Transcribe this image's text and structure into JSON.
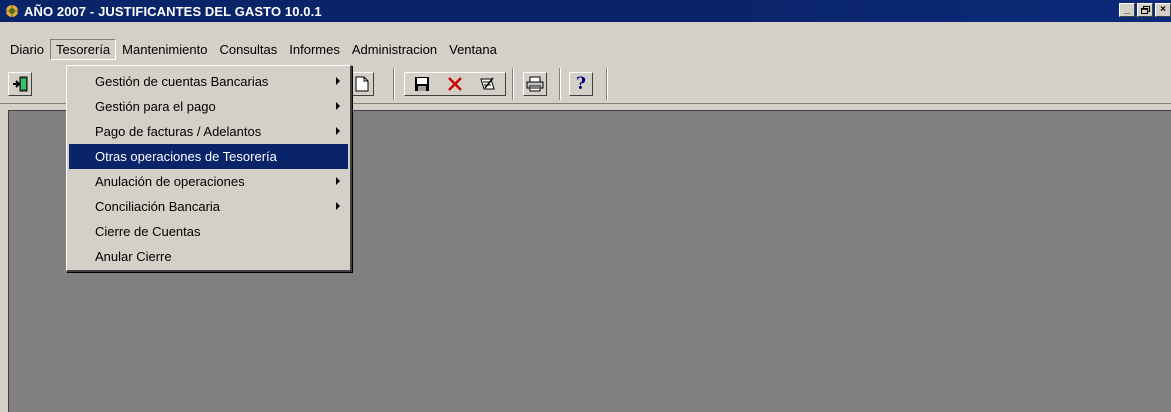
{
  "window": {
    "title": "AÑO 2007 - JUSTIFICANTES DEL GASTO 10.0.1",
    "minimize_label": "_",
    "maximize_label": "▫",
    "close_label": "×"
  },
  "menubar": {
    "items": [
      {
        "label": "Diario"
      },
      {
        "label": "Tesorería"
      },
      {
        "label": "Mantenimiento"
      },
      {
        "label": "Consultas"
      },
      {
        "label": "Informes"
      },
      {
        "label": "Administracion"
      },
      {
        "label": "Ventana"
      }
    ],
    "active_index": 1
  },
  "toolbar": {
    "help_label": "?",
    "icons": [
      "exit-icon",
      "new-document-icon",
      "save-icon",
      "delete-icon",
      "edit-icon",
      "print-icon",
      "help-icon"
    ]
  },
  "tesoreria_menu": {
    "items": [
      {
        "label": "Gestión de cuentas Bancarias",
        "submenu": true
      },
      {
        "label": "Gestión para el pago",
        "submenu": true
      },
      {
        "label": "Pago de facturas / Adelantos",
        "submenu": true
      },
      {
        "label": "Otras operaciones de Tesorería",
        "submenu": false
      },
      {
        "label": "Anulación de operaciones",
        "submenu": true
      },
      {
        "label": "Conciliación Bancaria",
        "submenu": true
      },
      {
        "label": "Cierre de Cuentas",
        "submenu": false
      },
      {
        "label": "Anular Cierre",
        "submenu": false
      }
    ],
    "selected_index": 3
  },
  "colors": {
    "title_bar": "#0a246a",
    "menu_face": "#d4d0c8",
    "workspace": "#808080",
    "selection": "#0a246a"
  }
}
